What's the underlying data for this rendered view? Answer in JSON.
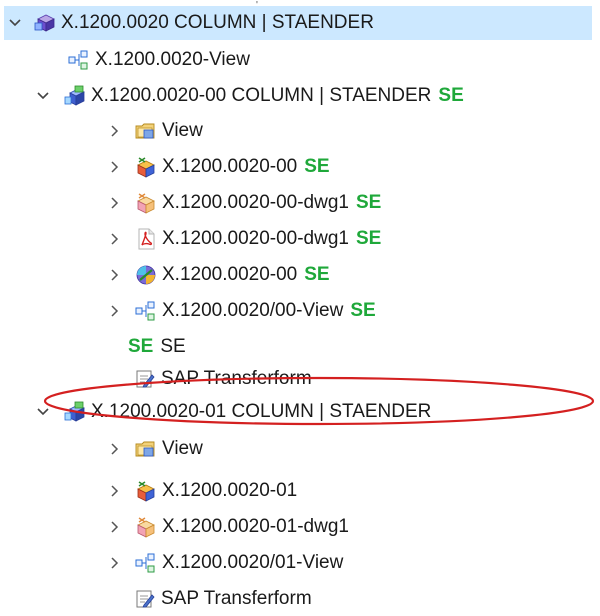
{
  "tree": {
    "selected_row": "X.1200.0020 COLUMN | STAENDER",
    "badge_color": "#1fa83a",
    "highlight_color": "#d42020",
    "rows": [
      {
        "label": "X.1200.0020 COLUMN | STAENDER",
        "icon": "assembly-icon",
        "expanded": true,
        "selected": true
      },
      {
        "label": "X.1200.0020-View",
        "icon": "view-structure-icon"
      },
      {
        "label": "X.1200.0020-00 COLUMN | STAENDER",
        "badge": "SE",
        "icon": "part-revision-icon",
        "expanded": true
      },
      {
        "label": "View",
        "icon": "view-folder-icon",
        "expandable": true
      },
      {
        "label": "X.1200.0020-00",
        "badge": "SE",
        "icon": "cad-model-icon",
        "expandable": true
      },
      {
        "label": "X.1200.0020-00-dwg1",
        "badge": "SE",
        "icon": "drawing-icon",
        "expandable": true
      },
      {
        "label": "X.1200.0020-00-dwg1",
        "badge": "SE",
        "icon": "pdf-icon",
        "expandable": true
      },
      {
        "label": "X.1200.0020-00",
        "badge": "SE",
        "icon": "visualization-icon",
        "expandable": true
      },
      {
        "label": "X.1200.0020/00-View",
        "badge": "SE",
        "icon": "view-structure-icon",
        "expandable": true
      },
      {
        "lead_badge": "SE",
        "label": "SE"
      },
      {
        "label": "SAP Transferform",
        "icon": "form-icon"
      },
      {
        "label": "X.1200.0020-01 COLUMN | STAENDER",
        "icon": "part-revision-icon",
        "expanded": true,
        "highlighted": true
      },
      {
        "label": "View",
        "icon": "view-folder-icon",
        "expandable": true
      },
      {
        "label": "X.1200.0020-01",
        "icon": "cad-model-icon",
        "expandable": true
      },
      {
        "label": "X.1200.0020-01-dwg1",
        "icon": "drawing-icon",
        "expandable": true
      },
      {
        "label": "X.1200.0020/01-View",
        "icon": "view-structure-icon",
        "expandable": true
      },
      {
        "label": "SAP Transferform",
        "icon": "form-icon"
      }
    ]
  }
}
